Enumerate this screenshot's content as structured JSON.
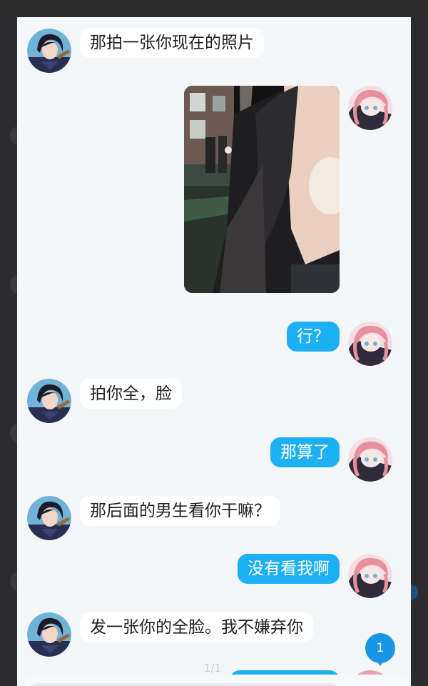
{
  "messages": [
    {
      "side": "in",
      "type": "text",
      "text": "那拍一张你现在的照片"
    },
    {
      "side": "out",
      "type": "image",
      "alt": ""
    },
    {
      "side": "out",
      "type": "text",
      "text": "行？"
    },
    {
      "side": "in",
      "type": "text",
      "text": "拍你全，脸"
    },
    {
      "side": "out",
      "type": "text",
      "text": "那算了"
    },
    {
      "side": "in",
      "type": "text",
      "text": "那后面的男生看你干嘛？"
    },
    {
      "side": "out",
      "type": "text",
      "text": "没有看我啊"
    },
    {
      "side": "in",
      "type": "text",
      "text": "发一张你的全脸。我不嫌弃你"
    }
  ],
  "page_indicator": "1/1",
  "unread_badge": "1",
  "colors": {
    "outgoing_bubble": "#1eb0f5",
    "incoming_bubble": "#ffffff",
    "badge": "#1796e6",
    "panel_bg": "#f4f6f8"
  },
  "icons": {
    "contact_avatar": "anime-boy-avatar",
    "self_avatar": "anime-pink-hair-avatar"
  }
}
